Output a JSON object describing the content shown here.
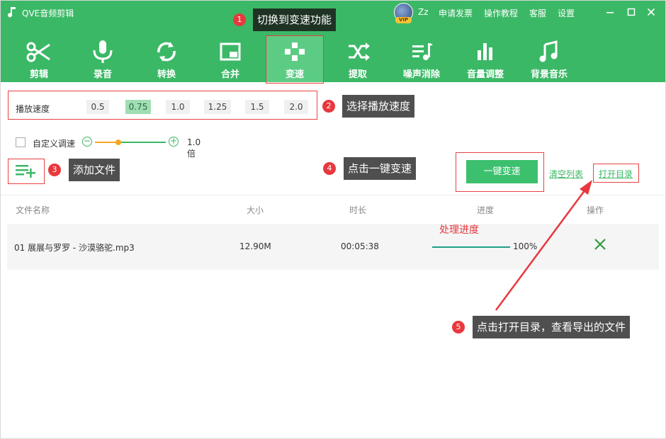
{
  "titlebar": {
    "app_title": "QVE音频剪辑",
    "vip_label": "VIP",
    "user_name": "Zz",
    "links": [
      "申请发票",
      "操作教程",
      "客服",
      "设置"
    ]
  },
  "toolbar": {
    "items": [
      {
        "label": "剪辑",
        "icon": "scissors-icon"
      },
      {
        "label": "录音",
        "icon": "microphone-icon"
      },
      {
        "label": "转换",
        "icon": "convert-icon"
      },
      {
        "label": "合并",
        "icon": "merge-icon"
      },
      {
        "label": "变速",
        "icon": "speed-icon",
        "active": true
      },
      {
        "label": "提取",
        "icon": "shuffle-icon"
      },
      {
        "label": "噪声消除",
        "icon": "denoise-icon"
      },
      {
        "label": "音量调整",
        "icon": "volume-bars-icon"
      },
      {
        "label": "背景音乐",
        "icon": "music-note-icon"
      }
    ]
  },
  "speed": {
    "label": "播放速度",
    "options": [
      "0.5",
      "0.75",
      "1.0",
      "1.25",
      "1.5",
      "2.0"
    ],
    "selected": "0.75"
  },
  "custom": {
    "label": "自定义调速",
    "checked": false,
    "slider_level": 0.33,
    "multiplier": "1.0倍"
  },
  "actions": {
    "one_click_speed": "一键变速",
    "clear_list": "清空列表",
    "open_dir": "打开目录"
  },
  "table": {
    "headers": [
      "文件名称",
      "大小",
      "时长",
      "进度",
      "操作"
    ],
    "rows": [
      {
        "name": "01 展展与罗罗 - 沙漠骆驼.mp3",
        "size": "12.90M",
        "duration": "00:05:38",
        "progress": "100%"
      }
    ]
  },
  "annotations": {
    "tip1": "切换到变速功能",
    "tip2": "选择播放速度",
    "tip3": "添加文件",
    "tip4": "点击一键变速",
    "tip5": "点击打开目录，查看导出的文件",
    "progress_note": "处理进度",
    "n1": "1",
    "n2": "2",
    "n3": "3",
    "n4": "4",
    "n5": "5"
  },
  "colors": {
    "brand_green": "#3bb866",
    "annotation_red": "#e8383d",
    "tip_gray": "#4f4f4f"
  }
}
